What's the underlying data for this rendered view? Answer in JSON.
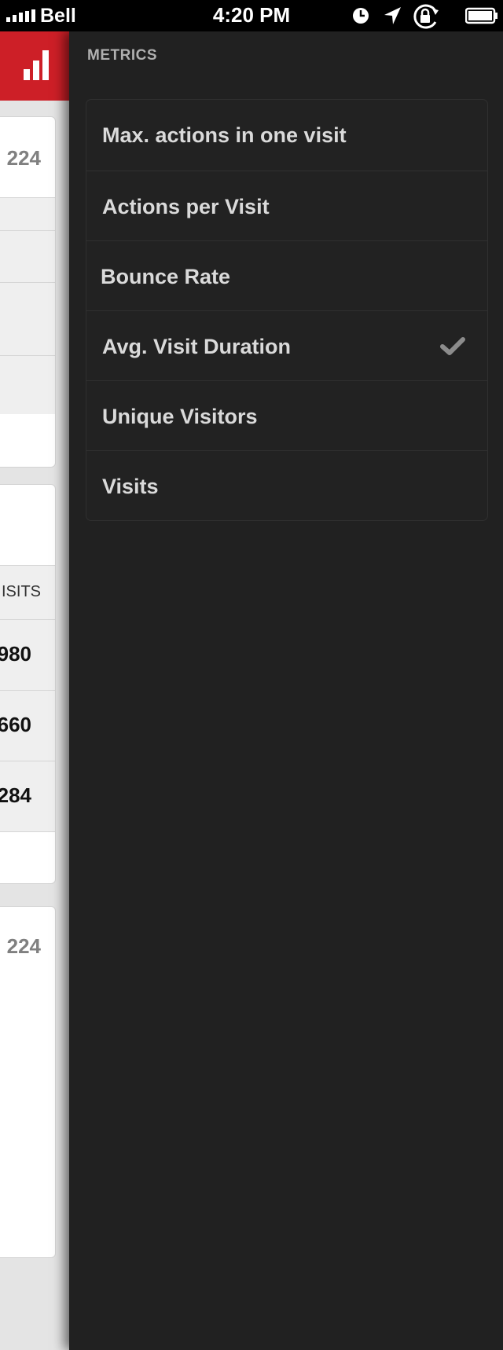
{
  "status_bar": {
    "carrier": "Bell",
    "time": "4:20 PM",
    "icons": [
      "signal-icon",
      "clock-icon",
      "location-arrow-icon",
      "rotation-lock-icon",
      "battery-icon"
    ]
  },
  "left_panel": {
    "header_color": "#cd1f27",
    "header_icon": "bar-chart-icon",
    "card1": {
      "value": "224"
    },
    "card2": {
      "column_label": "ISITS",
      "rows": [
        "980",
        "660",
        "284"
      ]
    },
    "card3": {
      "value": "224"
    }
  },
  "drawer": {
    "section_title": "METRICS",
    "metrics": [
      {
        "label": "Max. actions in one visit",
        "selected": false
      },
      {
        "label": "Actions per Visit",
        "selected": false
      },
      {
        "label": "Bounce Rate",
        "selected": false
      },
      {
        "label": "Avg. Visit Duration",
        "selected": true
      },
      {
        "label": "Unique Visitors",
        "selected": false
      },
      {
        "label": "Visits",
        "selected": false
      }
    ],
    "selected_indicator_icon": "checkmark-icon"
  }
}
